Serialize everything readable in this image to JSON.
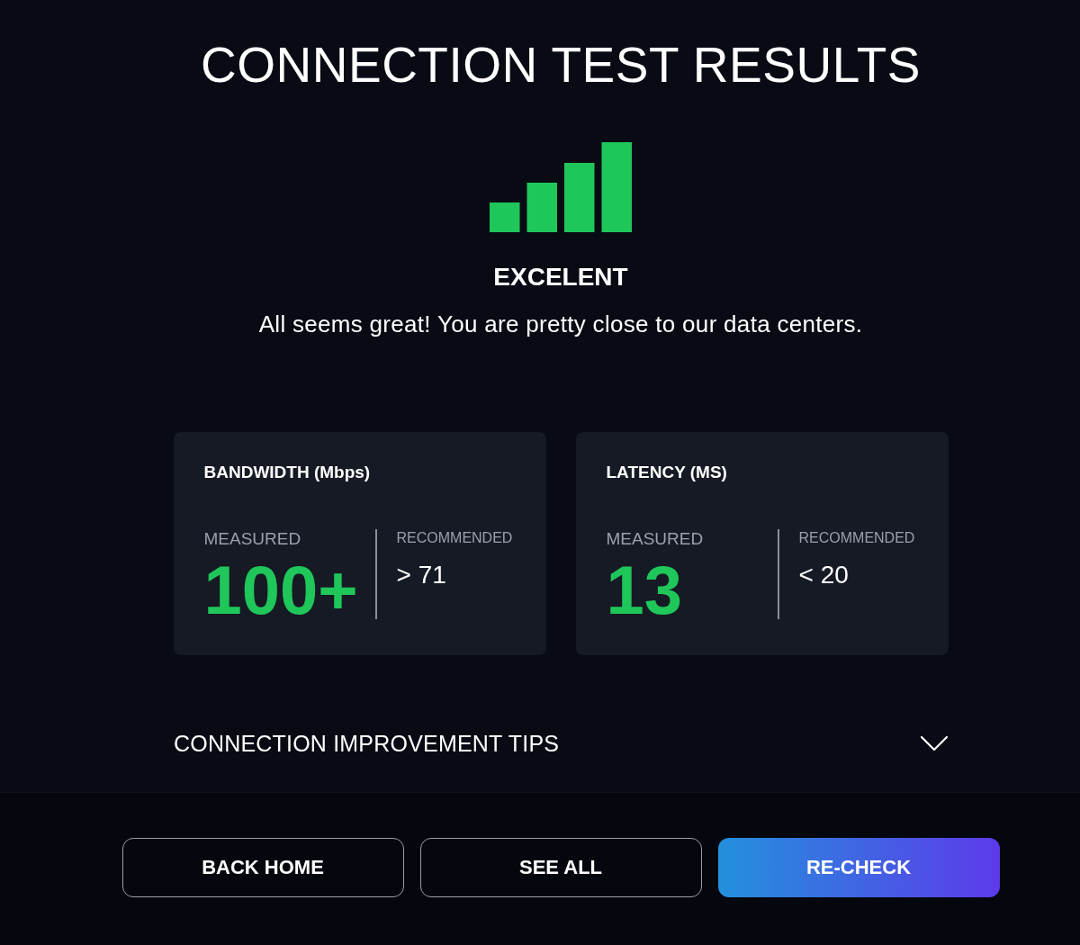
{
  "title": "CONNECTION TEST RESULTS",
  "status": {
    "rating": "EXCELENT",
    "message": "All seems great! You are pretty close to our data centers."
  },
  "metrics": [
    {
      "title": "BANDWIDTH (Mbps)",
      "measured_label": "MEASURED",
      "measured_value": "100+",
      "recommended_label": "RECOMMENDED",
      "recommended_value": "> 71"
    },
    {
      "title": "LATENCY (MS)",
      "measured_label": "MEASURED",
      "measured_value": "13",
      "recommended_label": "RECOMMENDED",
      "recommended_value": "< 20"
    }
  ],
  "tips": {
    "label": "CONNECTION IMPROVEMENT TIPS",
    "expanded": false
  },
  "buttons": [
    {
      "label": "BACK HOME",
      "kind": "outline"
    },
    {
      "label": "SEE ALL",
      "kind": "outline"
    },
    {
      "label": "RE-CHECK",
      "kind": "primary"
    }
  ]
}
